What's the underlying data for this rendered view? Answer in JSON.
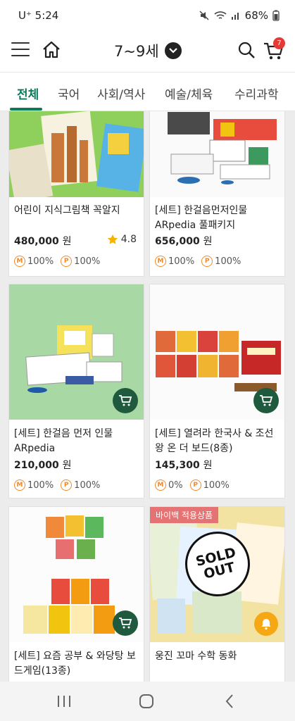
{
  "status": {
    "carrier": "U⁺ 5:24",
    "battery": "68%"
  },
  "header": {
    "age_label": "7~9세",
    "cart_count": "7"
  },
  "tabs": [
    "전체",
    "국어",
    "사회/역사",
    "예술/체육",
    "수리과학"
  ],
  "products": [
    {
      "title": "어린이 지식그림책 꼭알지",
      "price": "480,000",
      "won": "원",
      "rating": "4.8",
      "m": "100%",
      "p": "100%"
    },
    {
      "title": "[세트] 한걸음먼저인물 ARpedia 풀패키지",
      "price": "656,000",
      "won": "원",
      "m": "100%",
      "p": "100%"
    },
    {
      "title": "[세트] 한걸음 먼저 인물 ARpedia",
      "price": "210,000",
      "won": "원",
      "m": "100%",
      "p": "100%"
    },
    {
      "title": "[세트] 열려라 한국사 & 조선왕 온 더 보드(8종)",
      "price": "145,300",
      "won": "원",
      "m": "0%",
      "p": "100%"
    },
    {
      "title": "[세트] 요즘 공부 & 와당탕 보드게임(13종)"
    },
    {
      "title": "웅진 꼬마 수학 동화",
      "tag": "바이백 적용상품",
      "soldout": "SOLD OUT"
    }
  ],
  "point_labels": {
    "m": "M",
    "p": "P"
  },
  "colors": {
    "accent": "#0b7a5a",
    "cart_button": "#1f5a3e",
    "badge": "#e53935",
    "point": "#f08a2a"
  }
}
